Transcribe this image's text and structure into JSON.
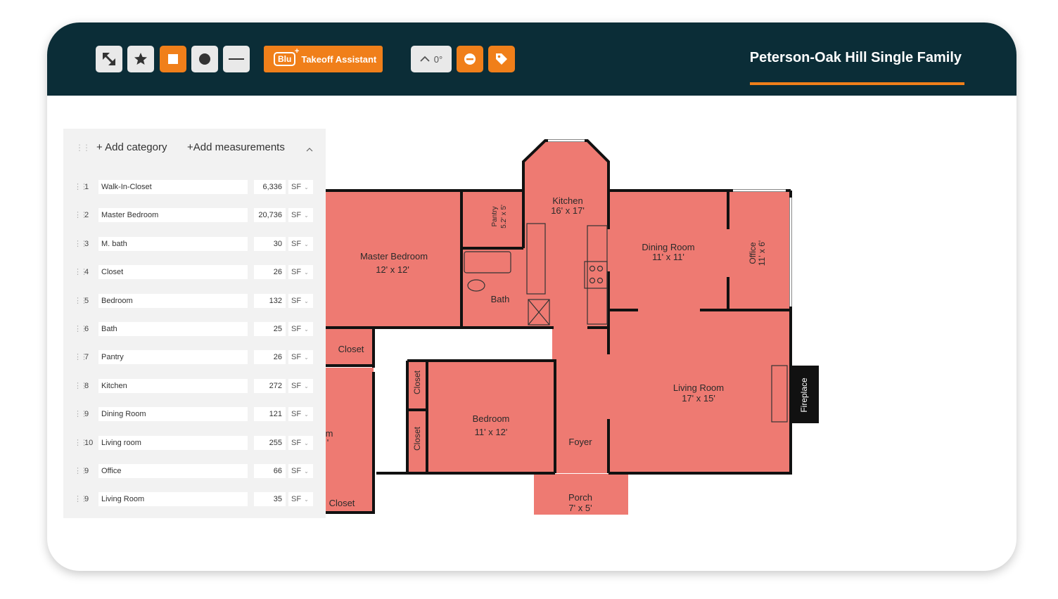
{
  "toolbar": {
    "tools": [
      {
        "icon": "pan-arrows-icon",
        "active": false
      },
      {
        "icon": "star-icon",
        "active": false
      },
      {
        "icon": "square-icon",
        "active": true
      },
      {
        "icon": "circle-icon",
        "active": false
      },
      {
        "icon": "line-icon",
        "active": false
      }
    ],
    "assistant_logo": "Blu",
    "assistant_label": "Takeoff Assistant",
    "angle_value": "0°",
    "accent_color": "#f07f1a",
    "bar_color": "#0b2d37"
  },
  "project": {
    "title": "Peterson-Oak Hill Single Family"
  },
  "panel": {
    "add_category": "+ Add category",
    "add_measurements": "+Add measurements",
    "rows": [
      {
        "num": "1",
        "name": "Walk-In-Closet",
        "value": "6,336",
        "unit": "SF"
      },
      {
        "num": "2",
        "name": "Master Bedroom",
        "value": "20,736",
        "unit": "SF"
      },
      {
        "num": "3",
        "name": "M. bath",
        "value": "30",
        "unit": "SF"
      },
      {
        "num": "4",
        "name": "Closet",
        "value": "26",
        "unit": "SF"
      },
      {
        "num": "5",
        "name": "Bedroom",
        "value": "132",
        "unit": "SF"
      },
      {
        "num": "6",
        "name": "Bath",
        "value": "25",
        "unit": "SF"
      },
      {
        "num": "7",
        "name": "Pantry",
        "value": "26",
        "unit": "SF"
      },
      {
        "num": "8",
        "name": "Kitchen",
        "value": "272",
        "unit": "SF"
      },
      {
        "num": "9",
        "name": "Dining Room",
        "value": "121",
        "unit": "SF"
      },
      {
        "num": "10",
        "name": "Living room",
        "value": "255",
        "unit": "SF"
      },
      {
        "num": "9",
        "name": "Office",
        "value": "66",
        "unit": "SF"
      },
      {
        "num": "9",
        "name": "Living Room",
        "value": "35",
        "unit": "SF"
      }
    ]
  },
  "floorplan": {
    "fill_color": "#ee7a72",
    "labels": {
      "master_bedroom": "Master Bedroom",
      "master_bedroom_dim": "12' x 12'",
      "pantry": "Pantry",
      "pantry_dim": "5.2' x 5'",
      "kitchen": "Kitchen",
      "kitchen_dim": "16' x 17'",
      "bath": "Bath",
      "dining": "Dining Room",
      "dining_dim": "11' x 11'",
      "office": "Office",
      "office_dim": "11' x 6'",
      "closet_a": "Closet",
      "closet_b": "Closet",
      "closet_c": "Closet",
      "closet_d": "Closet",
      "bedroom": "Bedroom",
      "bedroom_dim": "11' x 12'",
      "living": "Living Room",
      "living_dim": "17' x 15'",
      "fireplace": "Fireplace",
      "foyer": "Foyer",
      "porch": "Porch",
      "porch_dim": "7' x 5'",
      "cut_room": "m",
      "cut_dim": "'"
    }
  }
}
